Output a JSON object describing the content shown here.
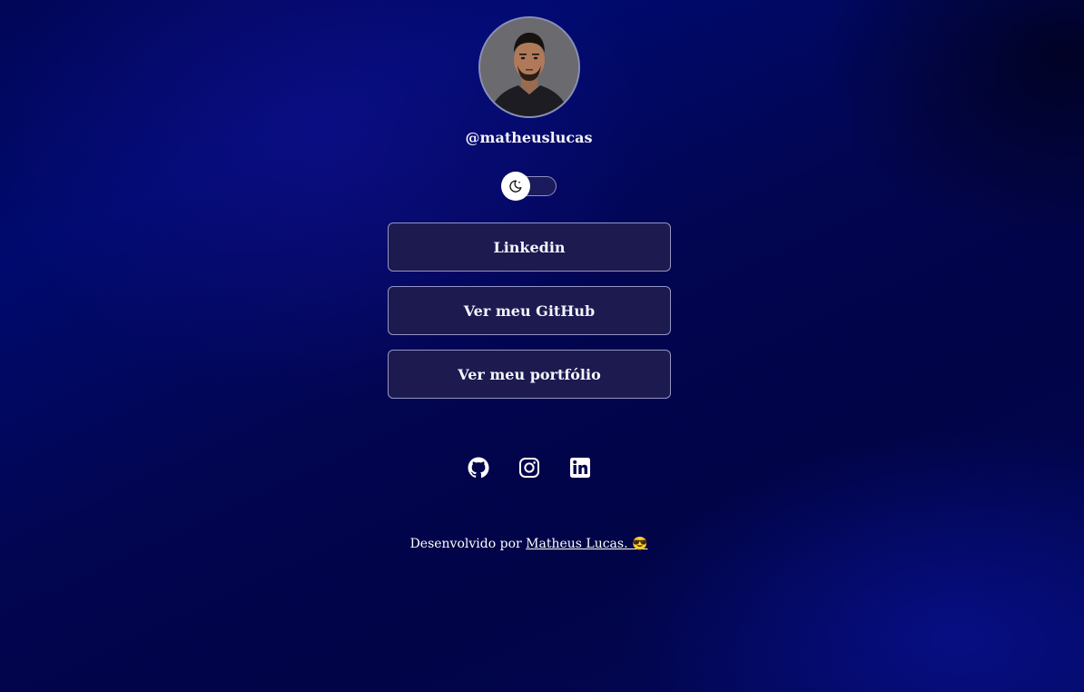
{
  "profile": {
    "username": "@matheuslucas",
    "avatar_icon": "profile-photo"
  },
  "theme_toggle": {
    "icon": "moon-icon",
    "state": "dark"
  },
  "links": [
    {
      "label": "Linkedin"
    },
    {
      "label": "Ver meu GitHub"
    },
    {
      "label": "Ver meu portfólio"
    }
  ],
  "social_icons": [
    "github-icon",
    "instagram-icon",
    "linkedin-icon"
  ],
  "footer": {
    "prefix": "Desenvolvido por",
    "author_link": "Matheus Lucas. 😎"
  },
  "colors": {
    "background": "#020550",
    "button_bg": "#1c1a4f",
    "button_border": "#9496c6",
    "text": "#ffffff"
  }
}
